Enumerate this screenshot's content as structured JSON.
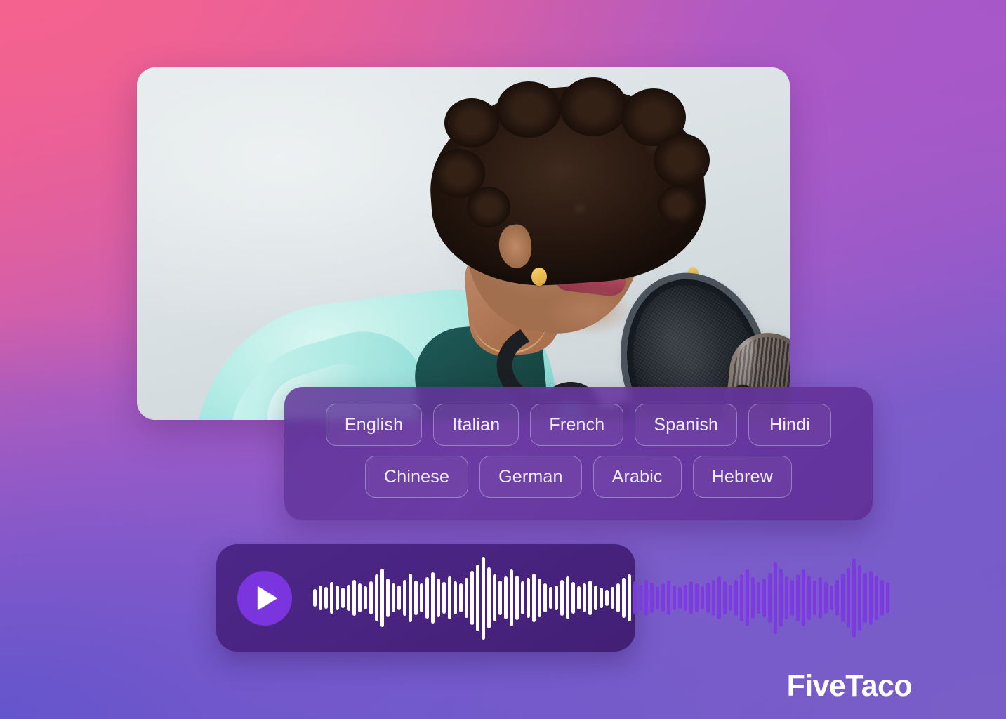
{
  "background": {
    "gradient_from": "#EE5F93",
    "gradient_mid": "#AF5DC6",
    "gradient_to": "#6A57CC"
  },
  "photo": {
    "alt": "Woman with curly hair wearing headphones speaking into a studio condenser microphone with pop filter",
    "subject_top_color": "#A9E8E2",
    "backdrop_color": "#DCE3E6"
  },
  "language_panel": {
    "rows": [
      {
        "chips": [
          "English",
          "Italian",
          "French",
          "Spanish",
          "Hindi"
        ]
      },
      {
        "chips": [
          "Chinese",
          "German",
          "Arabic",
          "Hebrew"
        ]
      }
    ],
    "panel_color": "#60308F",
    "chip_border_color": "#CDCDEB"
  },
  "audio_player": {
    "play_icon": "play-icon",
    "play_button_color": "#7B35DE",
    "player_background": "#48237F",
    "played_bar_color": "#FFFFFF",
    "unplayed_bar_color": "#7C3AE0",
    "progress_percent": 55,
    "waveform": [
      22,
      30,
      26,
      38,
      30,
      24,
      32,
      44,
      34,
      28,
      40,
      56,
      70,
      46,
      34,
      30,
      44,
      58,
      42,
      34,
      50,
      62,
      46,
      38,
      52,
      40,
      34,
      48,
      66,
      80,
      100,
      74,
      56,
      42,
      52,
      68,
      54,
      40,
      48,
      58,
      46,
      34,
      26,
      30,
      44,
      52,
      38,
      28,
      34,
      42,
      30,
      24,
      20,
      26,
      34,
      48,
      56,
      40,
      32,
      44,
      36,
      28,
      34,
      42,
      30,
      26,
      32,
      40,
      34,
      28,
      36,
      44,
      52,
      40,
      32,
      44,
      56,
      68,
      50,
      38,
      46,
      60,
      88,
      70,
      52,
      44,
      56,
      68,
      54,
      42,
      50,
      38,
      30,
      44,
      58,
      72,
      96,
      78,
      60,
      66,
      54,
      44,
      36
    ]
  },
  "brand": {
    "name": "FiveTaco"
  }
}
